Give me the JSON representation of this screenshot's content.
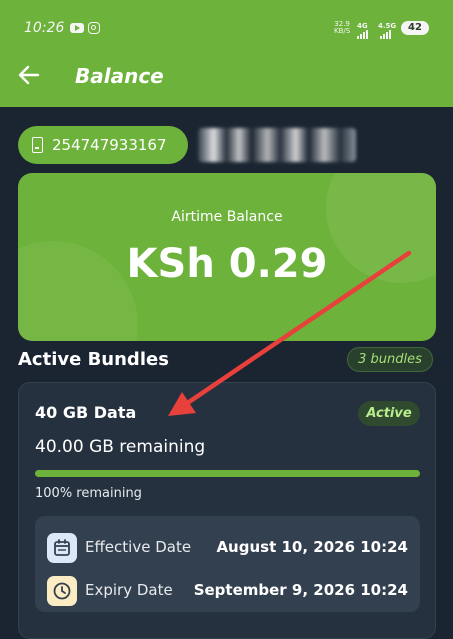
{
  "status_bar": {
    "time": "10:26",
    "speed_value": "32.9",
    "speed_unit": "KB/S",
    "signal_1": "4G",
    "signal_2": "4.5G",
    "battery": "42"
  },
  "header": {
    "title": "Balance"
  },
  "account": {
    "phone_number": "254747933167"
  },
  "airtime": {
    "label": "Airtime Balance",
    "value": "KSh 0.29"
  },
  "bundles": {
    "section_title": "Active Bundles",
    "count_label": "3 bundles",
    "items": [
      {
        "name": "40 GB Data",
        "status": "Active",
        "remaining": "40.00 GB remaining",
        "remaining_fraction": 1.0,
        "percent_label": "100% remaining",
        "effective_label": "Effective Date",
        "effective_value": "August 10, 2026 10:24",
        "expiry_label": "Expiry Date",
        "expiry_value": "September 9, 2026 10:24"
      }
    ]
  },
  "colors": {
    "brand_green": "#6db23a",
    "background": "#1b2532",
    "card": "#263140",
    "annotation_arrow": "#e8403b"
  },
  "icons": [
    "back-arrow-icon",
    "youtube-icon",
    "instagram-icon",
    "phone-icon",
    "calendar-icon",
    "clock-icon"
  ]
}
